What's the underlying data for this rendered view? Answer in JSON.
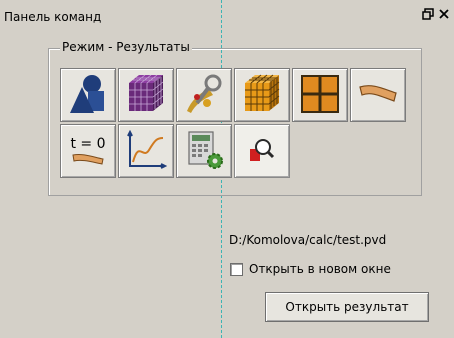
{
  "panel": {
    "title": "Панель команд",
    "float_icon": "float-icon",
    "close_icon": "close-icon"
  },
  "groupbox": {
    "label": "Режим - Результаты"
  },
  "tools": [
    {
      "icon": "geometry-shapes-icon"
    },
    {
      "icon": "purple-mesh-cube-icon"
    },
    {
      "icon": "material-wrench-icon"
    },
    {
      "icon": "orange-mesh-cube-icon"
    },
    {
      "icon": "grid-boundary-icon"
    },
    {
      "icon": "deformed-beam-icon"
    },
    {
      "icon": "initial-state-icon",
      "text": "t = 0"
    },
    {
      "icon": "graph-curve-icon"
    },
    {
      "icon": "calculator-gear-icon"
    },
    {
      "icon": "results-magnifier-icon",
      "active": true
    }
  ],
  "file_path": "D:/Komolova/calc/test.pvd",
  "open_new_window": {
    "label": "Открыть в новом окне",
    "checked": false
  },
  "open_button": {
    "label": "Открыть результат"
  }
}
